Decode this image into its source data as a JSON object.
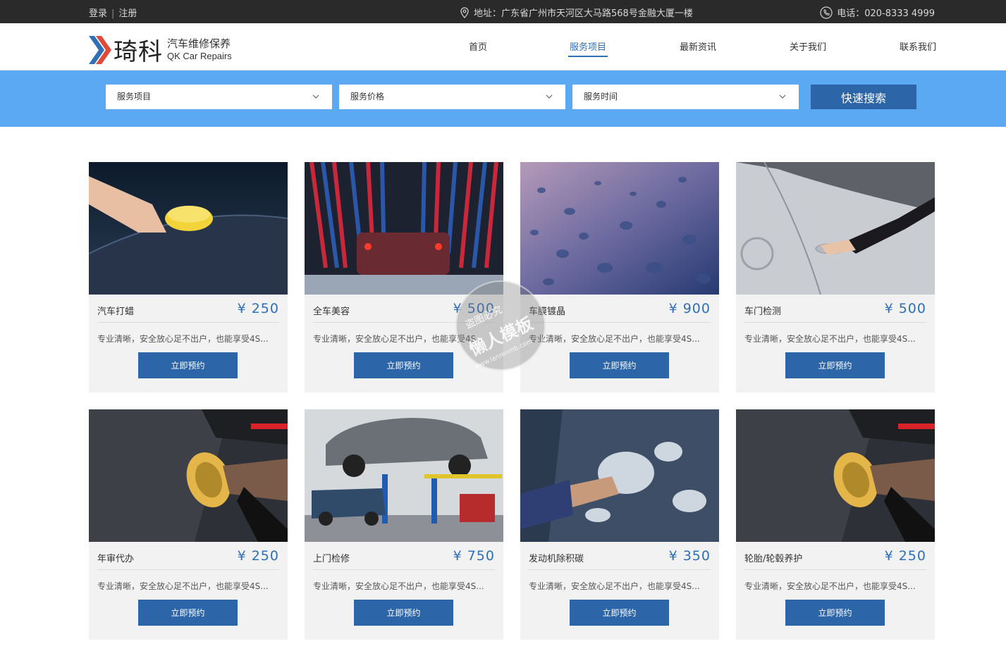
{
  "topbar": {
    "login": "登录",
    "separator": "|",
    "register": "注册",
    "address": "地址：广东省广州市天河区大马路568号金融大厦一楼",
    "phone": "电话：020-8333 4999"
  },
  "logo": {
    "name": "琦科",
    "subtitle_cn": "汽车维修保养",
    "subtitle_en": "QK Car Repairs",
    "colors": {
      "primary": "#2f6fb5",
      "accent": "#e04a3c"
    }
  },
  "nav": [
    {
      "label": "首页",
      "active": false
    },
    {
      "label": "服务项目",
      "active": true
    },
    {
      "label": "最新资讯",
      "active": false
    },
    {
      "label": "关于我们",
      "active": false
    },
    {
      "label": "联系我们",
      "active": false
    }
  ],
  "search": {
    "service_select": "服务项目",
    "price_select": "服务价格",
    "time_select": "服务时间",
    "button": "快速搜索"
  },
  "cards": [
    {
      "title": "汽车打蜡",
      "price": "¥ 250",
      "desc": "专业清晰，安全放心足不出户，也能享受4S...",
      "button": "立即预约"
    },
    {
      "title": "全车美容",
      "price": "¥ 500",
      "desc": "专业清晰，安全放心足不出户，也能享受4S...",
      "button": "立即预约"
    },
    {
      "title": "车膜镀晶",
      "price": "¥ 900",
      "desc": "专业清晰，安全放心足不出户，也能享受4S...",
      "button": "立即预约"
    },
    {
      "title": "车门检测",
      "price": "¥ 500",
      "desc": "专业清晰，安全放心足不出户，也能享受4S...",
      "button": "立即预约"
    },
    {
      "title": "年审代办",
      "price": "¥ 250",
      "desc": "专业清晰，安全放心足不出户，也能享受4S...",
      "button": "立即预约"
    },
    {
      "title": "上门检修",
      "price": "¥ 750",
      "desc": "专业清晰，安全放心足不出户，也能享受4S...",
      "button": "立即预约"
    },
    {
      "title": "发动机除积碳",
      "price": "¥ 350",
      "desc": "专业清晰，安全放心足不出户，也能享受4S...",
      "button": "立即预约"
    },
    {
      "title": "轮胎/轮毂养护",
      "price": "¥ 250",
      "desc": "专业清晰，安全放心足不出户，也能享受4S...",
      "button": "立即预约"
    }
  ],
  "watermark": {
    "line1": "盗图必究",
    "line2": "懒人模板",
    "line3": "www.lanrenmb.com"
  }
}
